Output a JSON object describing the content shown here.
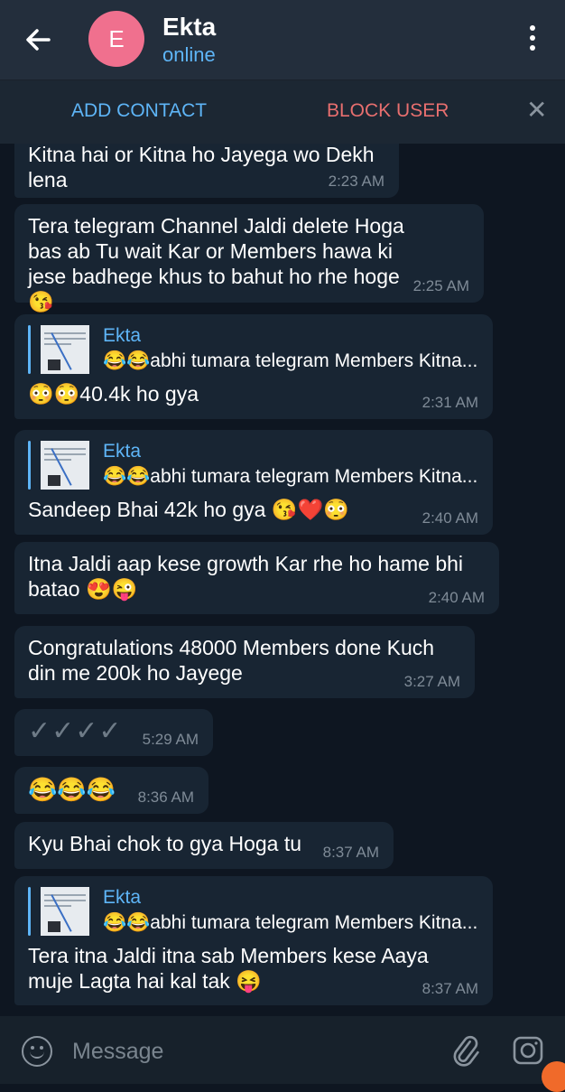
{
  "header": {
    "avatar_letter": "E",
    "name": "Ekta",
    "status": "online"
  },
  "actions": {
    "add_contact": "ADD CONTACT",
    "block_user": "BLOCK USER"
  },
  "colors": {
    "accent": "#5eb5f7",
    "danger": "#e86f6f",
    "avatar": "#f0708e",
    "bubble": "#182533",
    "background": "#0e1621"
  },
  "reply_preview": {
    "name": "Ekta",
    "text": "😂😂abhi tumara telegram Members Kitna..."
  },
  "messages": [
    {
      "text": "Kitna hai or Kitna ho Jayega wo Dekh lena",
      "time": "2:23 AM"
    },
    {
      "text": "Tera telegram Channel Jaldi delete Hoga bas ab Tu wait Kar or Members hawa ki jese badhege khus to bahut ho rhe hoge 😘",
      "time": "2:25 AM"
    },
    {
      "text": "😳😳40.4k ho gya",
      "time": "2:31 AM"
    },
    {
      "text": "Sandeep Bhai 42k ho gya 😘❤️😳",
      "time": "2:40 AM"
    },
    {
      "text": "Itna Jaldi aap kese growth Kar rhe ho hame bhi batao 😍😜",
      "time": "2:40 AM"
    },
    {
      "text": "Congratulations 48000 Members done Kuch din me 200k ho Jayege",
      "time": "3:27 AM"
    },
    {
      "text": "✓✓✓✓",
      "time": "5:29 AM"
    },
    {
      "text": "😂😂😂",
      "time": "8:36 AM"
    },
    {
      "text": "Kyu Bhai chok to gya Hoga tu",
      "time": "8:37 AM"
    },
    {
      "text": "Tera itna Jaldi itna sab Members kese Aaya muje Lagta hai kal tak 😝",
      "time": "8:37 AM"
    }
  ],
  "input": {
    "placeholder": "Message"
  },
  "icons": {
    "back": "arrow-left-icon",
    "menu": "more-vertical-icon",
    "close": "close-icon",
    "emoji": "smile-icon",
    "attach": "paperclip-icon",
    "camera": "camera-icon"
  }
}
